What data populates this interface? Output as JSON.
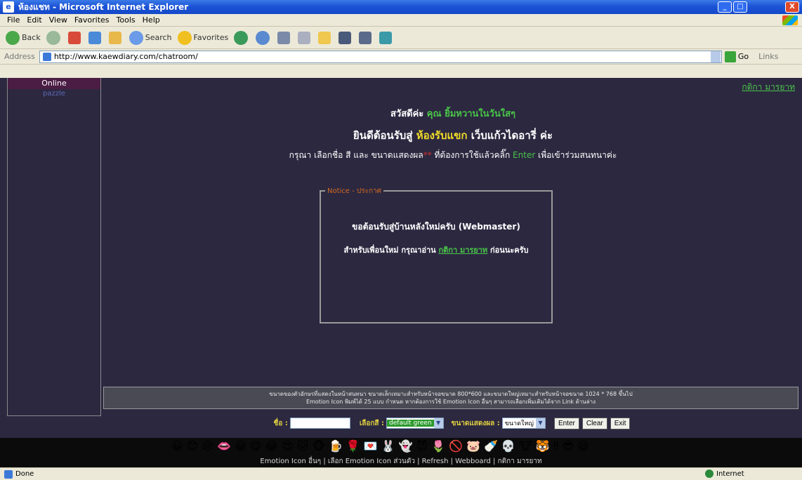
{
  "window": {
    "title": "ห้องแชท - Microsoft Internet Explorer",
    "controls": [
      "_",
      "□",
      "X"
    ]
  },
  "menu": [
    "File",
    "Edit",
    "View",
    "Favorites",
    "Tools",
    "Help"
  ],
  "toolbar": {
    "back": "Back",
    "search": "Search",
    "favorites": "Favorites"
  },
  "address": {
    "label": "Address",
    "url": "http://www.kaewdiary.com/chatroom/",
    "go": "Go",
    "links": "Links"
  },
  "sidebar": {
    "header": "Online",
    "users": [
      "pazzle"
    ]
  },
  "page": {
    "rules_link": "กติกา มารยาท",
    "greeting": {
      "prefix": "สวัสดีค่ะ",
      "name": "คุณ ยิ้มหวานในวันใสๆ"
    },
    "welcome": {
      "prefix": "ยินดีต้อนรับสู่",
      "room": "ห้องรับแขก",
      "suffix": "เว็บแก้วไดอารี่ ค่ะ"
    },
    "instruction": {
      "a": "กรุณา เลือกชื่อ สี และ ขนาดแสดงผล",
      "star": "**",
      "b": "ที่ต้องการใช้แล้วคลิ๊ก",
      "enter": "Enter",
      "c": "เพื่อเข้าร่วมสนทนาค่ะ"
    }
  },
  "notice": {
    "legend": "Notice - ประกาศ",
    "line1": "ขอต้อนรับสู่บ้านหลังใหม่ครับ (Webmaster)",
    "line2_prefix": "สำหรับเพื่อนใหม่ กรุณาอ่าน",
    "line2_link": "กติกา มารยาท",
    "line2_suffix": "ก่อนนะครับ"
  },
  "info": {
    "line1": "ขนาดของตัวอักษรที่แสดงในหน้าสนทนา ขนาดเล็กเหมาะสำหรับหน้าจอขนาด 800*600 และขนาดใหญ่เหมาะสำหรับหน้าจอขนาด 1024 * 768 ขึ้นไป",
    "line2": "Emotion Icon พิมพ์ได้ 25 แบบ กำหนด หากต้องการใช้ Emotion Icon อื่นๆ สามารถเลือกเพิ่มเติมได้จาก Link ด้านล่าง"
  },
  "form": {
    "name_label": "ชื่อ :",
    "name_value": "",
    "color_label": "เลือกสี :",
    "color_value": "default green",
    "size_label": "ขนาดแสดงผล :",
    "size_value": "ขนาดใหญ่",
    "enter": "Enter",
    "clear": "Clear",
    "exit": "Exit"
  },
  "emoticons": [
    "😀",
    "😊",
    "😢",
    "👄",
    "😁",
    "😋",
    "😂",
    "😍",
    "🐱",
    "🐵",
    "🍺",
    "🌹",
    "💌",
    "🐰",
    "👻",
    "😈",
    "🌷",
    "🚫",
    "🐷",
    "🍼",
    "💀",
    "🐮",
    "🐯",
    "‼",
    "😎",
    "😄"
  ],
  "emoticon_links": "Emotion Icon อื่นๆ | เลือก Emotion Icon ส่วนตัว | Refresh | Webboard | กติกา มารยาท",
  "status": {
    "left": "Done",
    "zone": "Internet"
  },
  "colors": {
    "page_bg": "#2c2840",
    "accent_green": "#49c548",
    "accent_yellow": "#f0dc28"
  }
}
